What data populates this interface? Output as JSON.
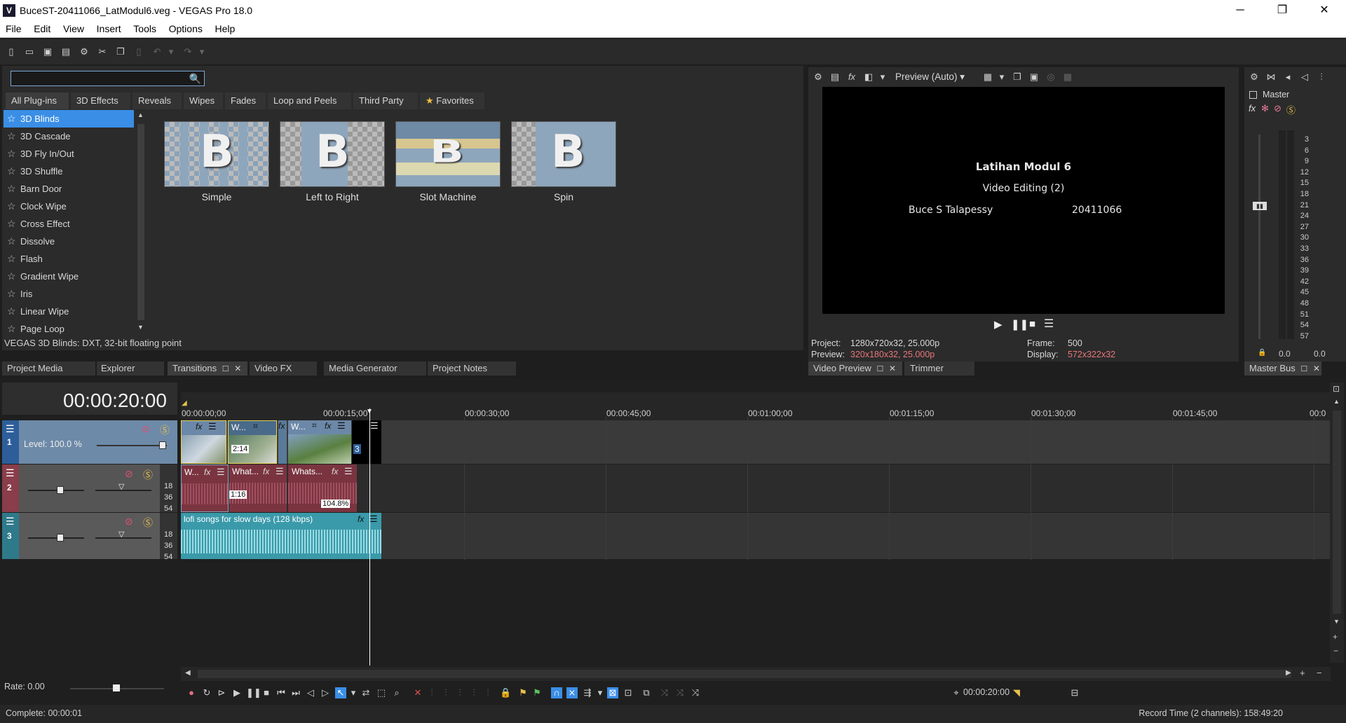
{
  "window": {
    "title": "BuceST-20411066_LatModul6.veg - VEGAS Pro 18.0",
    "app_icon": "V",
    "minimize": "─",
    "maximize": "❐",
    "close": "✕"
  },
  "menu": [
    "File",
    "Edit",
    "View",
    "Insert",
    "Tools",
    "Options",
    "Help"
  ],
  "transitions": {
    "search_value": "",
    "categories": [
      "All Plug-ins",
      "3D Effects",
      "Reveals",
      "Wipes",
      "Fades",
      "Loop and Peels",
      "Third Party",
      "Favorites"
    ],
    "list": [
      "3D Blinds",
      "3D Cascade",
      "3D Fly In/Out",
      "3D Shuffle",
      "Barn Door",
      "Clock Wipe",
      "Cross Effect",
      "Dissolve",
      "Flash",
      "Gradient Wipe",
      "Iris",
      "Linear Wipe",
      "Page Loop"
    ],
    "selected_index": 0,
    "presets": [
      "Simple",
      "Left to Right",
      "Slot Machine",
      "Spin"
    ],
    "status": "VEGAS 3D Blinds: DXT, 32-bit floating point"
  },
  "dock_tabs": [
    "Project Media",
    "Explorer",
    "Transitions",
    "Video FX",
    "Media Generator",
    "Project Notes"
  ],
  "preview": {
    "mode": "Preview (Auto)",
    "title_line1": "Latihan Modul 6",
    "title_line2": "Video Editing (2)",
    "name": "Buce S Talapessy",
    "nim": "20411066",
    "project_label": "Project:",
    "project_value": "1280x720x32, 25.000p",
    "preview_label": "Preview:",
    "preview_value": "320x180x32, 25.000p",
    "frame_label": "Frame:",
    "frame_value": "500",
    "display_label": "Display:",
    "display_value": "572x322x32",
    "tabs": [
      "Video Preview",
      "Trimmer"
    ]
  },
  "master": {
    "label": "Master",
    "scale": [
      "3",
      "6",
      "9",
      "12",
      "15",
      "18",
      "21",
      "24",
      "27",
      "30",
      "33",
      "36",
      "39",
      "42",
      "45",
      "48",
      "51",
      "54",
      "57"
    ],
    "left_val": "0.0",
    "right_val": "0.0",
    "tab": "Master Bus"
  },
  "timeline": {
    "timecode": "00:00:20:00",
    "ruler": [
      "00:00:00;00",
      "00:00:15;00",
      "00:00:30;00",
      "00:00:45;00",
      "00:01:00;00",
      "00:01:15;00",
      "00:01:30;00",
      "00:01:45;00",
      "00:0"
    ],
    "track1": {
      "num": "1",
      "level": "Level: 100.0 %"
    },
    "track2": {
      "num": "2",
      "db": [
        "18",
        "36",
        "54"
      ]
    },
    "track3": {
      "num": "3",
      "db": [
        "18",
        "36",
        "54"
      ]
    },
    "clips_v": [
      "W...",
      "W..."
    ],
    "clips_a": [
      "W...",
      "What...",
      "Whats..."
    ],
    "music_clip": "lofi songs for slow days (128 kbps)",
    "clip_time1": "2:14",
    "clip_time2": "1:16",
    "clip_pct": "104.8%",
    "clip_num3": "3",
    "rate": "Rate: 0.00",
    "cursor_time": "00:00:20:00"
  },
  "status": {
    "complete": "Complete: 00:00:01",
    "record_time": "Record Time (2 channels): 158:49:20"
  }
}
